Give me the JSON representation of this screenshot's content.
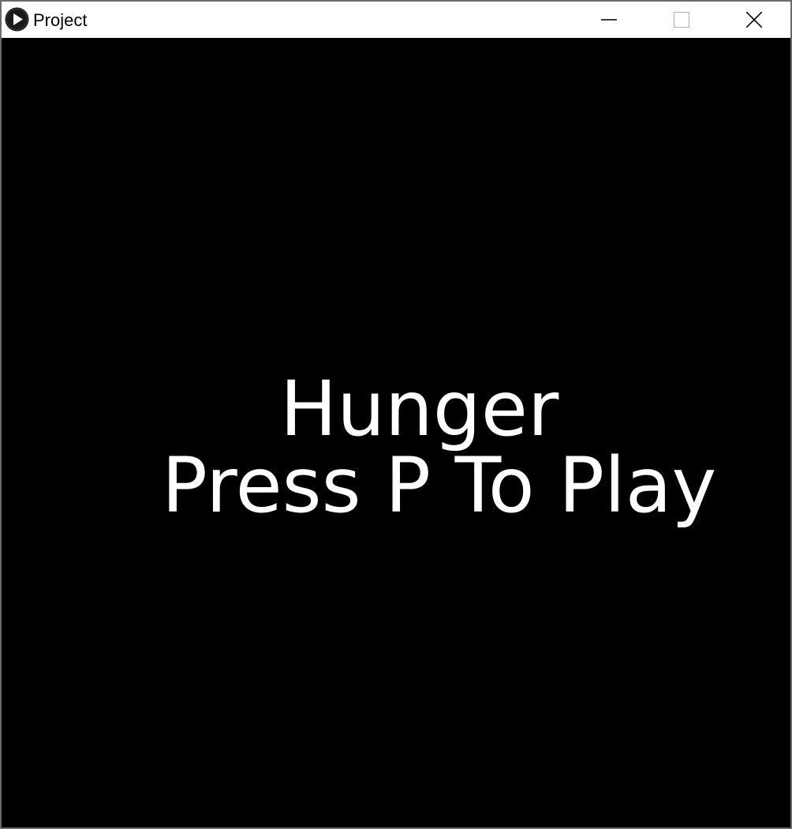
{
  "window": {
    "title": "Project",
    "app_icon": "play-circle-icon",
    "controls": {
      "minimize_icon": "minimize-icon",
      "maximize_icon": "maximize-icon",
      "close_icon": "close-icon"
    }
  },
  "game": {
    "title": "Hunger",
    "prompt": "Press P To Play",
    "background_color": "#000000",
    "text_color": "#ffffff"
  }
}
